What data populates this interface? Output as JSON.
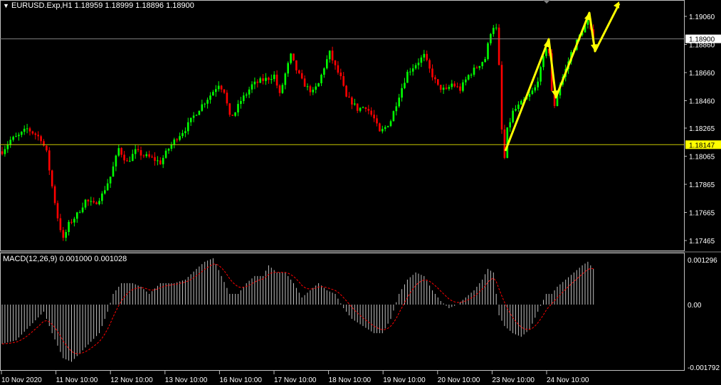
{
  "window": {
    "symbol_header": "EURUSD.Exp,H1  1.18959 1.18999 1.18896 1.18900"
  },
  "macd_header": "MACD(12,26,9) 0.001000 0.001028",
  "colors": {
    "background": "#000000",
    "bull": "#00ff00",
    "bear": "#ff0000",
    "grid_border": "#c0c0c0",
    "price_line": "#808080",
    "level_line": "#c8c800",
    "arrow": "#ffff00",
    "macd_hist": "#c0c0c0",
    "macd_signal": "#ff0000"
  },
  "chart_data": [
    {
      "type": "candlestick",
      "title": "EURUSD.Exp,H1",
      "ohlc_last": {
        "open": 1.18959,
        "high": 1.18999,
        "low": 1.18896,
        "close": 1.189
      },
      "y_ticks": [
        "1.19060",
        "1.18860",
        "1.18660",
        "1.18460",
        "1.18265",
        "1.18065",
        "1.17865",
        "1.17665",
        "1.17465"
      ],
      "y_tick_values": [
        1.1906,
        1.1886,
        1.1866,
        1.1846,
        1.18265,
        1.18065,
        1.17865,
        1.17665,
        1.17465
      ],
      "ylim": [
        1.1737,
        1.1922
      ],
      "x_ticks": [
        "10 Nov 2020",
        "11 Nov 10:00",
        "12 Nov 10:00",
        "13 Nov 10:00",
        "16 Nov 10:00",
        "17 Nov 10:00",
        "18 Nov 10:00",
        "19 Nov 10:00",
        "20 Nov 10:00",
        "23 Nov 10:00",
        "24 Nov 10:00"
      ],
      "current_price_label": "1.18900",
      "current_price": 1.189,
      "level_label": "1.18147",
      "level": 1.18147,
      "close_path": [
        [
          0,
          1.181
        ],
        [
          3,
          1.1818
        ],
        [
          6,
          1.1821
        ],
        [
          9,
          1.1826
        ],
        [
          12,
          1.1822
        ],
        [
          14,
          1.1819
        ],
        [
          16,
          1.1809
        ],
        [
          18,
          1.1785
        ],
        [
          20,
          1.1763
        ],
        [
          22,
          1.1747
        ],
        [
          24,
          1.1758
        ],
        [
          27,
          1.1765
        ],
        [
          30,
          1.1775
        ],
        [
          33,
          1.1772
        ],
        [
          36,
          1.1779
        ],
        [
          39,
          1.1792
        ],
        [
          42,
          1.1812
        ],
        [
          45,
          1.1802
        ],
        [
          48,
          1.181
        ],
        [
          51,
          1.1807
        ],
        [
          54,
          1.1805
        ],
        [
          57,
          1.1802
        ],
        [
          60,
          1.1812
        ],
        [
          63,
          1.182
        ],
        [
          66,
          1.1826
        ],
        [
          69,
          1.1835
        ],
        [
          72,
          1.1843
        ],
        [
          75,
          1.185
        ],
        [
          78,
          1.1858
        ],
        [
          80,
          1.1853
        ],
        [
          82,
          1.1834
        ],
        [
          84,
          1.1838
        ],
        [
          86,
          1.1846
        ],
        [
          88,
          1.1851
        ],
        [
          90,
          1.1857
        ],
        [
          93,
          1.186
        ],
        [
          96,
          1.1862
        ],
        [
          98,
          1.1864
        ],
        [
          100,
          1.185
        ],
        [
          102,
          1.1865
        ],
        [
          104,
          1.1878
        ],
        [
          106,
          1.1868
        ],
        [
          108,
          1.186
        ],
        [
          110,
          1.1855
        ],
        [
          112,
          1.1852
        ],
        [
          114,
          1.1858
        ],
        [
          116,
          1.187
        ],
        [
          118,
          1.188
        ],
        [
          120,
          1.187
        ],
        [
          122,
          1.1862
        ],
        [
          124,
          1.1848
        ],
        [
          126,
          1.1845
        ],
        [
          128,
          1.184
        ],
        [
          131,
          1.1842
        ],
        [
          134,
          1.1833
        ],
        [
          136,
          1.1823
        ],
        [
          138,
          1.1827
        ],
        [
          140,
          1.1832
        ],
        [
          143,
          1.185
        ],
        [
          146,
          1.1866
        ],
        [
          149,
          1.1872
        ],
        [
          152,
          1.1878
        ],
        [
          154,
          1.1868
        ],
        [
          157,
          1.1856
        ],
        [
          160,
          1.1853
        ],
        [
          162,
          1.1858
        ],
        [
          165,
          1.1854
        ],
        [
          168,
          1.1864
        ],
        [
          171,
          1.187
        ],
        [
          174,
          1.1876
        ],
        [
          176,
          1.1895
        ],
        [
          177,
          1.1899
        ],
        [
          178,
          1.1897
        ],
        [
          179,
          1.187
        ],
        [
          180,
          1.1825
        ],
        [
          181,
          1.1805
        ],
        [
          182,
          1.1825
        ],
        [
          184,
          1.1838
        ],
        [
          186,
          1.1842
        ],
        [
          188,
          1.1846
        ],
        [
          190,
          1.185
        ],
        [
          192,
          1.1855
        ],
        [
          194,
          1.1868
        ],
        [
          196,
          1.1884
        ],
        [
          197,
          1.188
        ],
        [
          198,
          1.1852
        ],
        [
          199,
          1.1843
        ],
        [
          201,
          1.1858
        ],
        [
          203,
          1.1868
        ],
        [
          205,
          1.188
        ],
        [
          207,
          1.1888
        ],
        [
          209,
          1.1896
        ],
        [
          211,
          1.1903
        ],
        [
          212,
          1.1895
        ],
        [
          213,
          1.189
        ]
      ]
    },
    {
      "type": "bar",
      "title": "MACD(12,26,9)",
      "main_value": 0.001,
      "signal_value": 0.001028,
      "y_ticks": [
        "0.001296",
        "0.00",
        "-0.001792"
      ],
      "y_tick_values": [
        0.001296,
        0.0,
        -0.001792
      ],
      "ylim": [
        -0.001792,
        0.001296
      ],
      "hist_path": [
        [
          0,
          -0.0011
        ],
        [
          5,
          -0.001
        ],
        [
          10,
          -0.0006
        ],
        [
          15,
          -0.0002
        ],
        [
          18,
          -0.0008
        ],
        [
          22,
          -0.0015
        ],
        [
          25,
          -0.0016
        ],
        [
          30,
          -0.0012
        ],
        [
          35,
          -0.0008
        ],
        [
          38,
          -0.0002
        ],
        [
          40,
          0.0003
        ],
        [
          43,
          0.0006
        ],
        [
          47,
          0.0006
        ],
        [
          50,
          0.0005
        ],
        [
          53,
          0.0003
        ],
        [
          57,
          0.0006
        ],
        [
          62,
          0.0006
        ],
        [
          66,
          0.0007
        ],
        [
          70,
          0.001
        ],
        [
          73,
          0.0012
        ],
        [
          76,
          0.0013
        ],
        [
          79,
          0.0008
        ],
        [
          82,
          0.0003
        ],
        [
          85,
          0.0003
        ],
        [
          88,
          0.0006
        ],
        [
          91,
          0.0008
        ],
        [
          94,
          0.0008
        ],
        [
          96,
          0.0011
        ],
        [
          99,
          0.0009
        ],
        [
          102,
          0.0009
        ],
        [
          105,
          0.0006
        ],
        [
          108,
          0.0002
        ],
        [
          111,
          0.0004
        ],
        [
          114,
          0.0006
        ],
        [
          117,
          0.0004
        ],
        [
          120,
          0.0003
        ],
        [
          123,
          -0.0001
        ],
        [
          126,
          -0.0004
        ],
        [
          130,
          -0.0006
        ],
        [
          134,
          -0.0008
        ],
        [
          137,
          -0.0008
        ],
        [
          140,
          -0.0004
        ],
        [
          143,
          0.0003
        ],
        [
          146,
          0.0007
        ],
        [
          149,
          0.0009
        ],
        [
          152,
          0.0008
        ],
        [
          155,
          0.0004
        ],
        [
          158,
          0.0001
        ],
        [
          161,
          -0.0001
        ],
        [
          164,
          0.0
        ],
        [
          167,
          0.0002
        ],
        [
          170,
          0.0004
        ],
        [
          173,
          0.0007
        ],
        [
          175,
          0.001
        ],
        [
          177,
          0.0009
        ],
        [
          179,
          -0.0003
        ],
        [
          181,
          -0.0006
        ],
        [
          184,
          -0.0008
        ],
        [
          187,
          -0.0009
        ],
        [
          190,
          -0.0007
        ],
        [
          193,
          -0.0002
        ],
        [
          196,
          0.0003
        ],
        [
          198,
          0.0003
        ],
        [
          200,
          0.0005
        ],
        [
          203,
          0.0007
        ],
        [
          206,
          0.0009
        ],
        [
          209,
          0.0011
        ],
        [
          211,
          0.0012
        ],
        [
          213,
          0.001
        ]
      ]
    }
  ]
}
